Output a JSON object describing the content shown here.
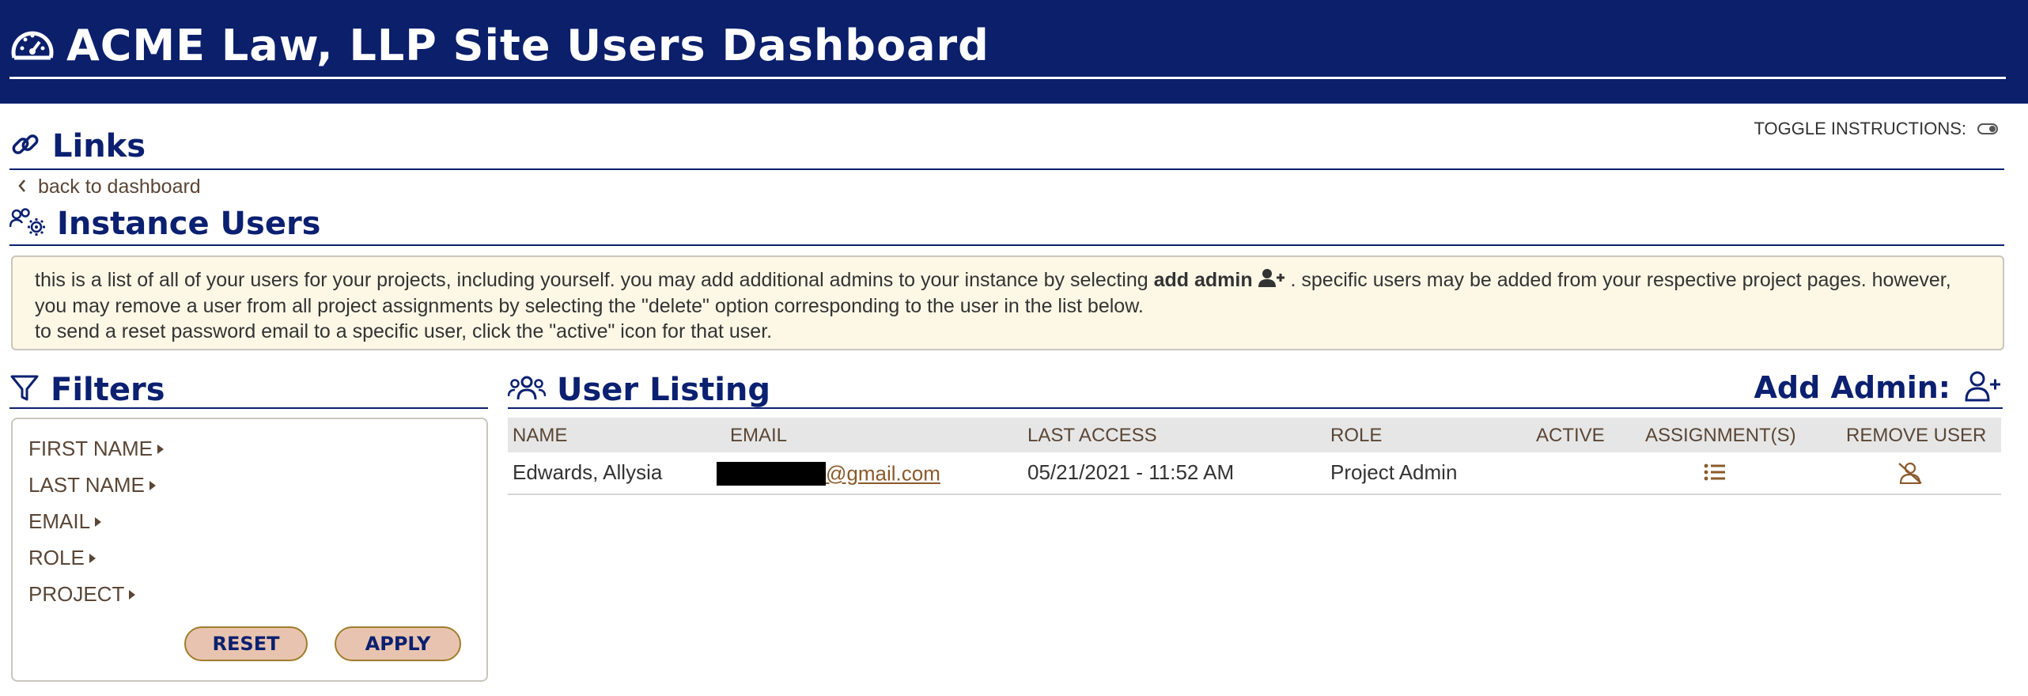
{
  "header": {
    "title": "ACME Law, LLP Site Users Dashboard",
    "icon": "dashboard-gauge-icon"
  },
  "links": {
    "title": "Links",
    "icon": "link-icon",
    "back_label": "back to dashboard"
  },
  "toggle": {
    "label": "TOGGLE INSTRUCTIONS:",
    "state": "on"
  },
  "instance_users": {
    "title": "Instance Users",
    "icon": "users-gear-icon"
  },
  "instructions": {
    "line1_pre": "this is a list of all of your users for your projects, including yourself. you may add additional admins to your instance by selecting ",
    "line1_bold": "add admin",
    "line1_post": " . specific users may be added from your respective project pages. however,",
    "line2": "you may remove a user from all project assignments by selecting the \"delete\" option corresponding to the user in the list below.",
    "line3": "to send a reset password email to a specific user, click the \"active\" icon for that user."
  },
  "filters": {
    "title": "Filters",
    "icon": "filter-funnel-icon",
    "items": [
      {
        "label": "FIRST NAME"
      },
      {
        "label": "LAST NAME"
      },
      {
        "label": "EMAIL"
      },
      {
        "label": "ROLE"
      },
      {
        "label": "PROJECT"
      }
    ],
    "reset_label": "RESET",
    "apply_label": "APPLY"
  },
  "user_listing": {
    "title": "User Listing",
    "icon": "users-group-icon",
    "add_admin_label": "Add Admin:",
    "columns": [
      "NAME",
      "EMAIL",
      "LAST ACCESS",
      "ROLE",
      "ACTIVE",
      "ASSIGNMENT(S)",
      "REMOVE USER"
    ],
    "rows": [
      {
        "name": "Edwards, Allysia",
        "email_visible": "@gmail.com",
        "last_access": "05/21/2021 - 11:52 AM",
        "role": "Project Admin",
        "active_icon": "sleep-zzz-icon",
        "assignments_icon": "list-icon",
        "remove_icon": "user-slash-icon"
      }
    ]
  },
  "colors": {
    "navy": "#0b1f6b",
    "accent_brown": "#8a5a2b",
    "info_bg": "#fdf8e6",
    "button_bg": "#e8c4b0"
  }
}
